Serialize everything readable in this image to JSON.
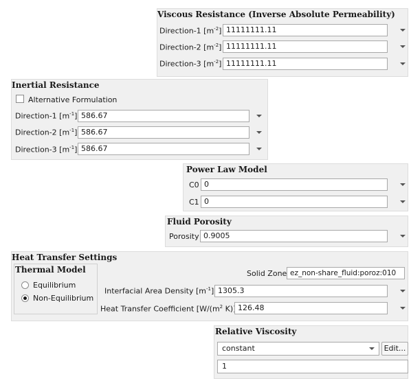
{
  "viscous_resistance": {
    "title": "Viscous Resistance (Inverse Absolute Permeability)",
    "rows": [
      {
        "label": "Direction-1 [m",
        "sup": "-2",
        "close": "]",
        "value": "11111111.11"
      },
      {
        "label": "Direction-2 [m",
        "sup": "-2",
        "close": "]",
        "value": "11111111.11"
      },
      {
        "label": "Direction-3 [m",
        "sup": "-2",
        "close": "]",
        "value": "11111111.11"
      }
    ]
  },
  "inertial_resistance": {
    "title": "Inertial Resistance",
    "alt_formulation_label": "Alternative Formulation",
    "alt_formulation_checked": false,
    "rows": [
      {
        "label": "Direction-1 [m",
        "sup": "-1",
        "close": "]",
        "value": "586.67"
      },
      {
        "label": "Direction-2 [m",
        "sup": "-1",
        "close": "]",
        "value": "586.67"
      },
      {
        "label": "Direction-3 [m",
        "sup": "-1",
        "close": "]",
        "value": "586.67"
      }
    ]
  },
  "power_law": {
    "title": "Power Law Model",
    "c0_label": "C0",
    "c0_value": "0",
    "c1_label": "C1",
    "c1_value": "0"
  },
  "fluid_porosity": {
    "title": "Fluid Porosity",
    "porosity_label": "Porosity",
    "porosity_value": "0.9005"
  },
  "heat_transfer": {
    "title": "Heat Transfer Settings",
    "thermal_model_title": "Thermal Model",
    "option_equilibrium": "Equilibrium",
    "option_non_equilibrium": "Non-Equilibrium",
    "selected": "Non-Equilibrium",
    "solid_zone_label": "Solid Zone",
    "solid_zone_value": "ez_non-share_fluid:poroz:010",
    "iad_label": "Interfacial Area Density [m",
    "iad_sup": "-1",
    "iad_close": "]",
    "iad_value": "1305.3",
    "htc_label": "Heat Transfer Coefficient [W/(m",
    "htc_sup": "2",
    "htc_close": " K)]",
    "htc_value": "126.48"
  },
  "relative_viscosity": {
    "title": "Relative Viscosity",
    "method": "constant",
    "edit_label": "Edit...",
    "value": "1"
  }
}
